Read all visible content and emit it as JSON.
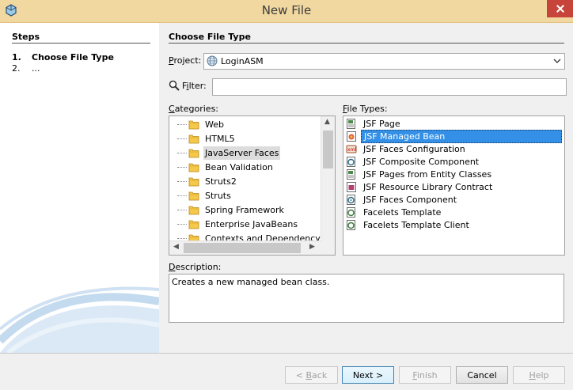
{
  "window": {
    "title": "New File"
  },
  "steps": {
    "title": "Steps",
    "items": [
      {
        "num": "1.",
        "label": "Choose File Type"
      },
      {
        "num": "2.",
        "label": "..."
      }
    ]
  },
  "main": {
    "title": "Choose File Type",
    "project": {
      "label_mnemonic": "P",
      "label_rest": "roject:",
      "value": "LoginASM"
    },
    "filter": {
      "label_pre": "F",
      "label_mnemonic": "i",
      "label_rest": "lter:",
      "value": ""
    },
    "categories": {
      "label_mnemonic": "C",
      "label_rest": "ategories:",
      "items": [
        "Web",
        "HTML5",
        "JavaServer Faces",
        "Bean Validation",
        "Struts2",
        "Struts",
        "Spring Framework",
        "Enterprise JavaBeans",
        "Contexts and Dependency Inje"
      ],
      "selected": "JavaServer Faces"
    },
    "file_types": {
      "label_mnemonic": "F",
      "label_rest": "ile Types:",
      "items": [
        {
          "label": "JSF Page",
          "icon": "jsf-page-icon"
        },
        {
          "label": "JSF Managed Bean",
          "icon": "managed-bean-icon"
        },
        {
          "label": "JSF Faces Configuration",
          "icon": "faces-config-icon"
        },
        {
          "label": "JSF Composite Component",
          "icon": "composite-component-icon"
        },
        {
          "label": "JSF Pages from Entity Classes",
          "icon": "jsf-page-icon"
        },
        {
          "label": "JSF Resource Library Contract",
          "icon": "resource-library-icon"
        },
        {
          "label": "JSF Faces Component",
          "icon": "faces-component-icon"
        },
        {
          "label": "Facelets Template",
          "icon": "facelets-template-icon"
        },
        {
          "label": "Facelets Template Client",
          "icon": "facelets-template-icon"
        }
      ],
      "selected": "JSF Managed Bean"
    },
    "description": {
      "label_mnemonic": "D",
      "label_rest": "escription:",
      "text": "Creates a new managed bean class."
    }
  },
  "buttons": {
    "back": {
      "pre": "< ",
      "mnemonic": "B",
      "rest": "ack"
    },
    "next": "Next >",
    "finish": {
      "mnemonic": "F",
      "rest": "inish"
    },
    "cancel": "Cancel",
    "help": {
      "mnemonic": "H",
      "rest": "elp"
    }
  },
  "colors": {
    "titlebar": "#f1d7a0",
    "close": "#c7443a",
    "selection": "#3390e6"
  }
}
